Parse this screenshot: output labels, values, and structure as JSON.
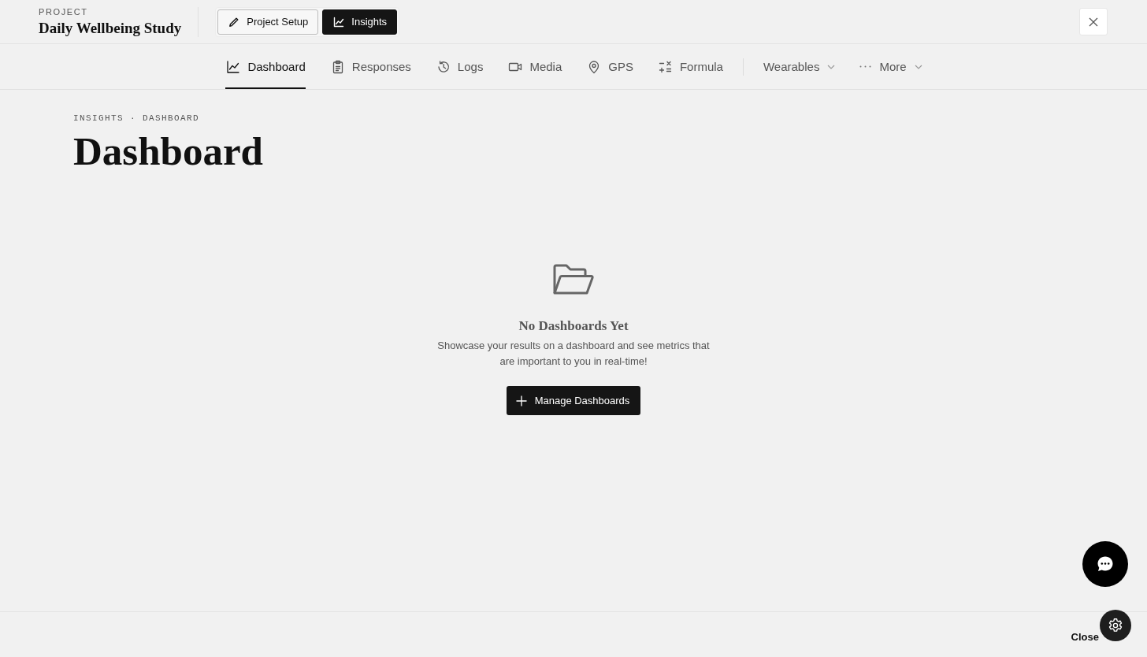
{
  "header": {
    "eyebrow": "PROJECT",
    "title": "Daily Wellbeing Study",
    "modes": [
      {
        "label": "Project Setup",
        "selected": false
      },
      {
        "label": "Insights",
        "selected": true
      }
    ]
  },
  "nav": {
    "tabs": [
      {
        "label": "Dashboard",
        "selected": true
      },
      {
        "label": "Responses",
        "selected": false
      },
      {
        "label": "Logs",
        "selected": false
      },
      {
        "label": "Media",
        "selected": false
      },
      {
        "label": "GPS",
        "selected": false
      },
      {
        "label": "Formula",
        "selected": false
      }
    ],
    "menus": [
      {
        "label": "Wearables"
      },
      {
        "label": "More"
      }
    ]
  },
  "page": {
    "breadcrumb": "INSIGHTS · DASHBOARD",
    "title": "Dashboard"
  },
  "empty_state": {
    "title": "No Dashboards Yet",
    "description": "Showcase your results on a dashboard and see metrics that are important to you in real-time!",
    "action": "Manage Dashboards"
  },
  "footer": {
    "close_label": "Close"
  }
}
